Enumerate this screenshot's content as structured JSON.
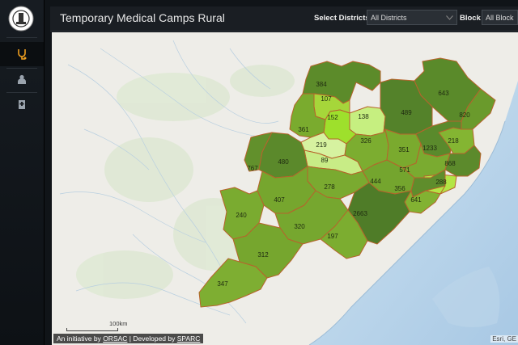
{
  "header": {
    "title": "Temporary Medical Camps Rural",
    "district_label": "Select Districts",
    "district_value": "All Districts",
    "block_label": "Block",
    "block_value": "All Block"
  },
  "sidebar": {
    "items": [
      {
        "name": "medical-camp",
        "icon": "stethoscope-icon"
      },
      {
        "name": "doctor",
        "icon": "doctor-icon"
      },
      {
        "name": "hospital",
        "icon": "hospital-icon"
      }
    ]
  },
  "map": {
    "districts": [
      {
        "value": "384",
        "color": "#5c8b2a"
      },
      {
        "value": "107",
        "color": "#a6d63a"
      },
      {
        "value": "152",
        "color": "#9ee02c"
      },
      {
        "value": "138",
        "color": "#c6ef80"
      },
      {
        "value": "489",
        "color": "#54822a"
      },
      {
        "value": "643",
        "color": "#5a8a2a"
      },
      {
        "value": "820",
        "color": "#6a9a2c"
      },
      {
        "value": "361",
        "color": "#7aab2e"
      },
      {
        "value": "219",
        "color": "#d6f2a0"
      },
      {
        "value": "89",
        "color": "#c8ec86"
      },
      {
        "value": "326",
        "color": "#7cad30"
      },
      {
        "value": "351",
        "color": "#7aaa2e"
      },
      {
        "value": "1233",
        "color": "#5a8a2c"
      },
      {
        "value": "218",
        "color": "#84b532"
      },
      {
        "value": "767",
        "color": "#62902c"
      },
      {
        "value": "480",
        "color": "#5b892b"
      },
      {
        "value": "571",
        "color": "#7aab30"
      },
      {
        "value": "868",
        "color": "#5c8a2c"
      },
      {
        "value": "288",
        "color": "#b3e545"
      },
      {
        "value": "444",
        "color": "#74a52e"
      },
      {
        "value": "356",
        "color": "#5f8d2c"
      },
      {
        "value": "641",
        "color": "#82b232"
      },
      {
        "value": "278",
        "color": "#7aaa30"
      },
      {
        "value": "407",
        "color": "#76a62e"
      },
      {
        "value": "2663",
        "color": "#4f7c28"
      },
      {
        "value": "240",
        "color": "#7aab30"
      },
      {
        "value": "320",
        "color": "#76a72f"
      },
      {
        "value": "197",
        "color": "#7cad30"
      },
      {
        "value": "312",
        "color": "#76a62e"
      },
      {
        "value": "347",
        "color": "#7eae32"
      }
    ],
    "scale_label": "100km",
    "credit": {
      "initiative": "An initiative by",
      "orsac": "ORSAC",
      "separator": "|",
      "developed": "Developed by",
      "sparc": "SPARC"
    },
    "esri": "Esri, GE"
  }
}
